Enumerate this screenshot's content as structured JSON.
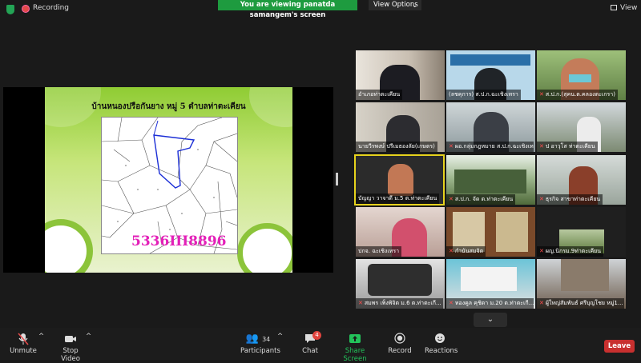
{
  "topbar": {
    "recording_label": "Recording",
    "banner_text": "You are viewing panatda samangem's screen",
    "view_options_label": "View Options",
    "view_label": "View"
  },
  "slide": {
    "title": "บ้านหนองปรือกันยาง หมู่ 5 ตำบลท่าตะเคียน",
    "parcel_code": "5336III8896"
  },
  "participants_grid": [
    {
      "name": "อำเภอท่าตะเคียน",
      "muted": false
    },
    {
      "name": "(ลชคุการ) ส.ป.ก.ฉะเชิงเทรา",
      "muted": false
    },
    {
      "name": "ส.ป.ก.(สุคน.ต.คลองตะเกรา)",
      "muted": true
    },
    {
      "name": "นายวีรพงษ์ ปรีเมธองลัย(เกษตร)",
      "muted": false
    },
    {
      "name": "ผอ.กลุ่มกฎหมาย ส.ป.ก.ฉะเชิงเทรา",
      "muted": true
    },
    {
      "name": "ป อาวุโส ท่าตะเคียน",
      "muted": true
    },
    {
      "name": "บัญญา วาจาดี ม.5 ต.ท่าตะเคียน",
      "muted": false
    },
    {
      "name": "ส.ป.ก. จัด ต.ท่าตะเคียน",
      "muted": true
    },
    {
      "name": "ธุรกิจ สาขาท่าตะเคียน",
      "muted": true
    },
    {
      "name": "ปกจ. ฉะเชิงเทรา",
      "muted": false
    },
    {
      "name": "กำนันสมจิต",
      "muted": true
    },
    {
      "name": "ผญ.นิกรม.9ท่าตะเคียน",
      "muted": true
    },
    {
      "name": "สมพร เพ็งพิจิต ม.6 ต.ท่าตะเกี...",
      "muted": true
    },
    {
      "name": "ทองคูล คุชิดา ม.20 ต.ท่าตะเกี...",
      "muted": true
    },
    {
      "name": "ผู้ใหญ่สัมพันธ์ ศรีบุญโชย หมู่1...",
      "muted": true
    }
  ],
  "toolbar": {
    "unmute": "Unmute",
    "stop_video": "Stop Video",
    "participants": "Participants",
    "participants_count": "34",
    "chat": "Chat",
    "chat_badge": "4",
    "share_screen": "Share Screen",
    "record": "Record",
    "reactions": "Reactions",
    "leave": "Leave"
  },
  "colors": {
    "share_green": "#23c35a",
    "leave_red": "#c8302f",
    "active_speaker": "#e6d21c",
    "banner_green": "#1e9b3f"
  }
}
